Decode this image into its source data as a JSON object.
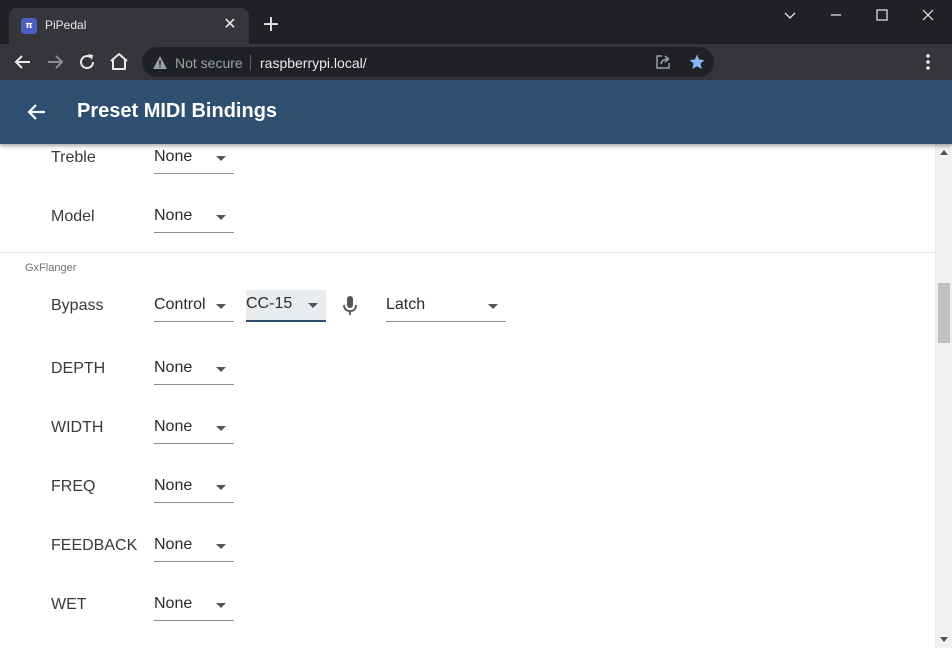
{
  "browser": {
    "tab_title": "PiPedal",
    "tab_favicon_text": "π",
    "security_text": "Not secure",
    "url": "raspberrypi.local/"
  },
  "app": {
    "title": "Preset MIDI Bindings"
  },
  "rows_top": [
    {
      "label": "Treble",
      "value": "None"
    },
    {
      "label": "Model",
      "value": "None"
    }
  ],
  "section": {
    "title": "GxFlanger"
  },
  "bypass": {
    "label": "Bypass",
    "type": "Control",
    "cc": "CC-15",
    "mode": "Latch"
  },
  "rows_flanger": [
    {
      "label": "DEPTH",
      "value": "None"
    },
    {
      "label": "WIDTH",
      "value": "None"
    },
    {
      "label": "FREQ",
      "value": "None"
    },
    {
      "label": "FEEDBACK",
      "value": "None"
    },
    {
      "label": "WET",
      "value": "None"
    }
  ],
  "colors": {
    "appbar": "#2e4f70",
    "star": "#8ab4f8"
  }
}
